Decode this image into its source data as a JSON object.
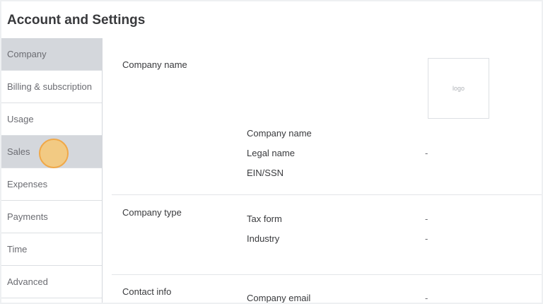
{
  "page": {
    "title": "Account and Settings"
  },
  "sidebar": {
    "items": [
      {
        "label": "Company"
      },
      {
        "label": "Billing & subscription"
      },
      {
        "label": "Usage"
      },
      {
        "label": "Sales"
      },
      {
        "label": "Expenses"
      },
      {
        "label": "Payments"
      },
      {
        "label": "Time"
      },
      {
        "label": "Advanced"
      }
    ],
    "selected": "Company",
    "hovered": "Sales"
  },
  "company_name_section": {
    "title": "Company name",
    "logo_placeholder": "logo",
    "fields": [
      {
        "label": "Company name",
        "value": ""
      },
      {
        "label": "Legal name",
        "value": "-"
      },
      {
        "label": "EIN/SSN",
        "value": ""
      }
    ]
  },
  "company_type_section": {
    "title": "Company type",
    "fields": [
      {
        "label": "Tax form",
        "value": "-"
      },
      {
        "label": "Industry",
        "value": "-"
      }
    ]
  },
  "contact_info_section": {
    "title": "Contact info",
    "fields": [
      {
        "label": "Company email",
        "value": "-"
      }
    ]
  },
  "colors": {
    "selected_bg": "#d4d7dc",
    "click_marker": "#f7c873",
    "text_primary": "#393a3d",
    "text_secondary": "#6b6c72"
  }
}
